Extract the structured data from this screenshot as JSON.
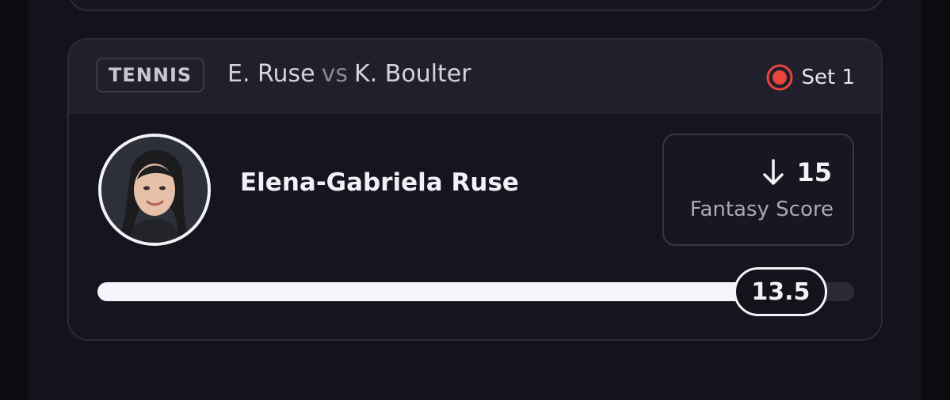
{
  "match": {
    "sport_badge": "TENNIS",
    "player1_short": "E. Ruse",
    "vs_label": "vs",
    "player2_short": "K. Boulter",
    "status_label": "Set 1",
    "status_icon": "live-record-icon",
    "status_color": "#e8453c"
  },
  "player": {
    "name": "Elena-Gabriela Ruse",
    "avatar_icon": "player-photo"
  },
  "fantasy": {
    "value": "15",
    "direction_icon": "arrow-down-icon",
    "label": "Fantasy Score"
  },
  "progress": {
    "line_value": "13.5",
    "fill_fraction": 0.903,
    "marker_fraction": 0.903
  }
}
